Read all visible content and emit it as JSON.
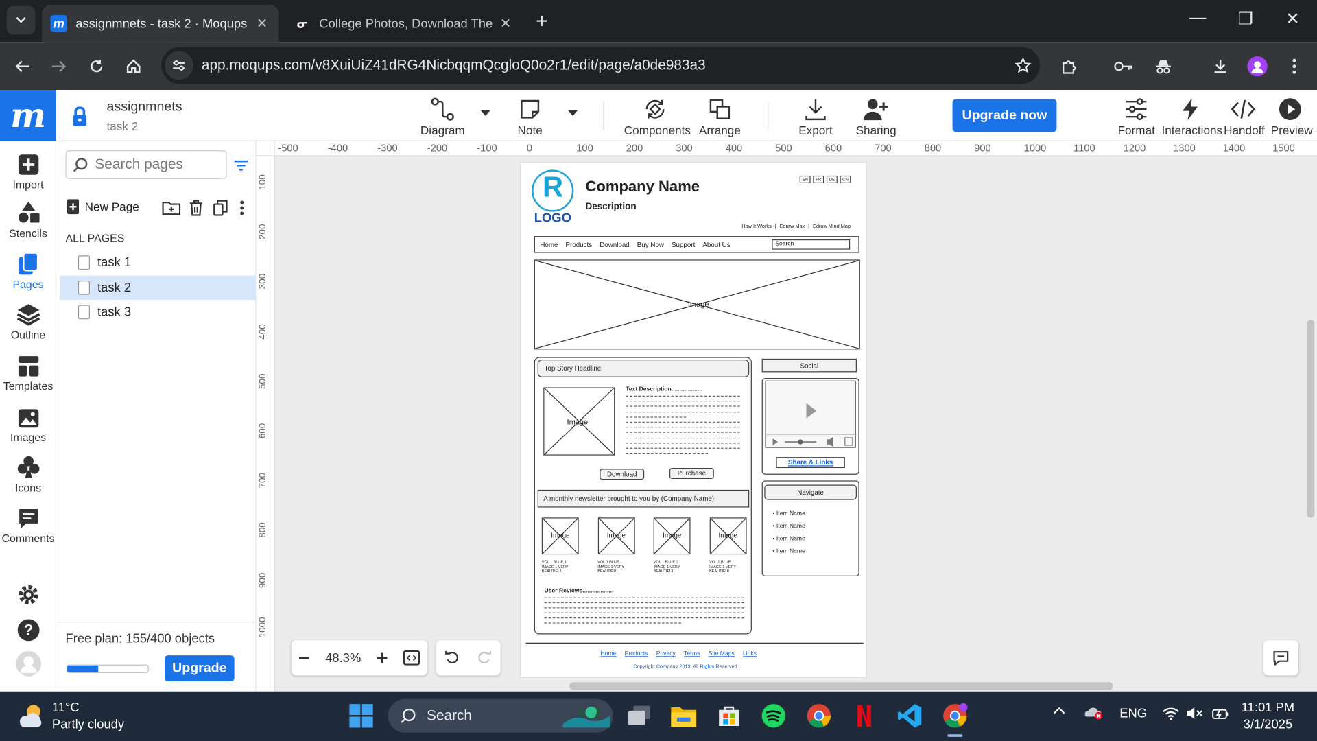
{
  "browser": {
    "tabs": [
      {
        "title": "assignmnets - task 2 · Moqups",
        "active": true
      },
      {
        "title": "College Photos, Download The",
        "active": false
      }
    ],
    "url": "app.moqups.com/v8XuiUiZ41dRG4NicbqqmQcgloQ0o2r1/edit/page/a0de983a3"
  },
  "app": {
    "logo": "m",
    "project_name": "assignmnets",
    "current_page": "task 2",
    "left_nav": [
      {
        "label": "Import",
        "icon": "import-icon"
      },
      {
        "label": "Stencils",
        "icon": "stencils-icon"
      },
      {
        "label": "Pages",
        "icon": "pages-icon",
        "active": true
      },
      {
        "label": "Outline",
        "icon": "outline-icon"
      },
      {
        "label": "Templates",
        "icon": "templates-icon"
      },
      {
        "label": "Images",
        "icon": "images-icon"
      },
      {
        "label": "Icons",
        "icon": "icons-icon"
      },
      {
        "label": "Comments",
        "icon": "comments-icon"
      }
    ],
    "toolbar": {
      "diagram": "Diagram",
      "note": "Note",
      "components": "Components",
      "arrange": "Arrange",
      "export": "Export",
      "sharing": "Sharing",
      "upgrade_now": "Upgrade now",
      "format": "Format",
      "interactions": "Interactions",
      "handoff": "Handoff",
      "preview": "Preview"
    },
    "accent_color": "#1b73e8"
  },
  "pages_panel": {
    "search_placeholder": "Search pages",
    "new_page": "New Page",
    "all_pages_label": "ALL PAGES",
    "pages": [
      {
        "name": "task 1",
        "selected": false
      },
      {
        "name": "task 2",
        "selected": true
      },
      {
        "name": "task 3",
        "selected": false
      }
    ],
    "free_plan": "Free plan: 155/400 objects",
    "usage_fraction": 0.3875,
    "upgrade": "Upgrade"
  },
  "canvas": {
    "zoom": "48.3%",
    "ruler_h": [
      "-500",
      "-400",
      "-300",
      "-200",
      "-100",
      "0",
      "100",
      "200",
      "300",
      "400",
      "500",
      "600",
      "700",
      "800",
      "900",
      "1000",
      "1100",
      "1200",
      "1300",
      "1400",
      "1500"
    ],
    "ruler_v": [
      "100",
      "200",
      "300",
      "400",
      "500",
      "600",
      "700",
      "800",
      "900",
      "1000"
    ]
  },
  "wireframe": {
    "logo_letter": "R",
    "logo_text": "LOGO",
    "company": "Company Name",
    "description": "Description",
    "languages": [
      "EN",
      "FR",
      "DE",
      "CN"
    ],
    "top_links": [
      "How It Works",
      "Edraw Max",
      "Edraw Mind Map"
    ],
    "nav": [
      "Home",
      "Products",
      "Download",
      "Buy Now",
      "Support",
      "About Us"
    ],
    "search": "Search",
    "hero_image": "Image",
    "top_story": "Top Story Headline",
    "story_image": "Image",
    "text_description": "Text Description...................",
    "download": "Download",
    "purchase": "Purchase",
    "newsletter": "A monthly newsletter brought to you by (Company Name)",
    "thumbs": [
      {
        "label": "Image",
        "caption1": "VOL 1 BLUE 1",
        "caption2": "IMAGE 1 VERY",
        "caption3": "BEAUTIFUL"
      },
      {
        "label": "Image",
        "caption1": "VOL 1 BLUE 1",
        "caption2": "IMAGE 1 VERY",
        "caption3": "BEAUTIFUL"
      },
      {
        "label": "Image",
        "caption1": "VOL 1 BLUE 1",
        "caption2": "IMAGE 1 VERY",
        "caption3": "BEAUTIFUL"
      },
      {
        "label": "Image",
        "caption1": "VOL 1 BLUE 1",
        "caption2": "IMAGE 1 VERY",
        "caption3": "BEAUTIFUL"
      }
    ],
    "user_reviews": "User Reviews...................",
    "social": "Social",
    "share_links": "Share & Links",
    "navigate": "Navigate",
    "nav_items": [
      "Item Name",
      "Item Name",
      "Item Name",
      "Item Name"
    ],
    "footer_links": [
      "Home",
      "Products",
      "Privacy",
      "Terms",
      "Site Maps",
      "Links"
    ],
    "copyright": "Copyright Company 2013, All Rights Reserved"
  },
  "taskbar": {
    "temperature": "11°C",
    "condition": "Partly cloudy",
    "search": "Search",
    "language": "ENG",
    "time": "11:01 PM",
    "date": "3/1/2025"
  }
}
